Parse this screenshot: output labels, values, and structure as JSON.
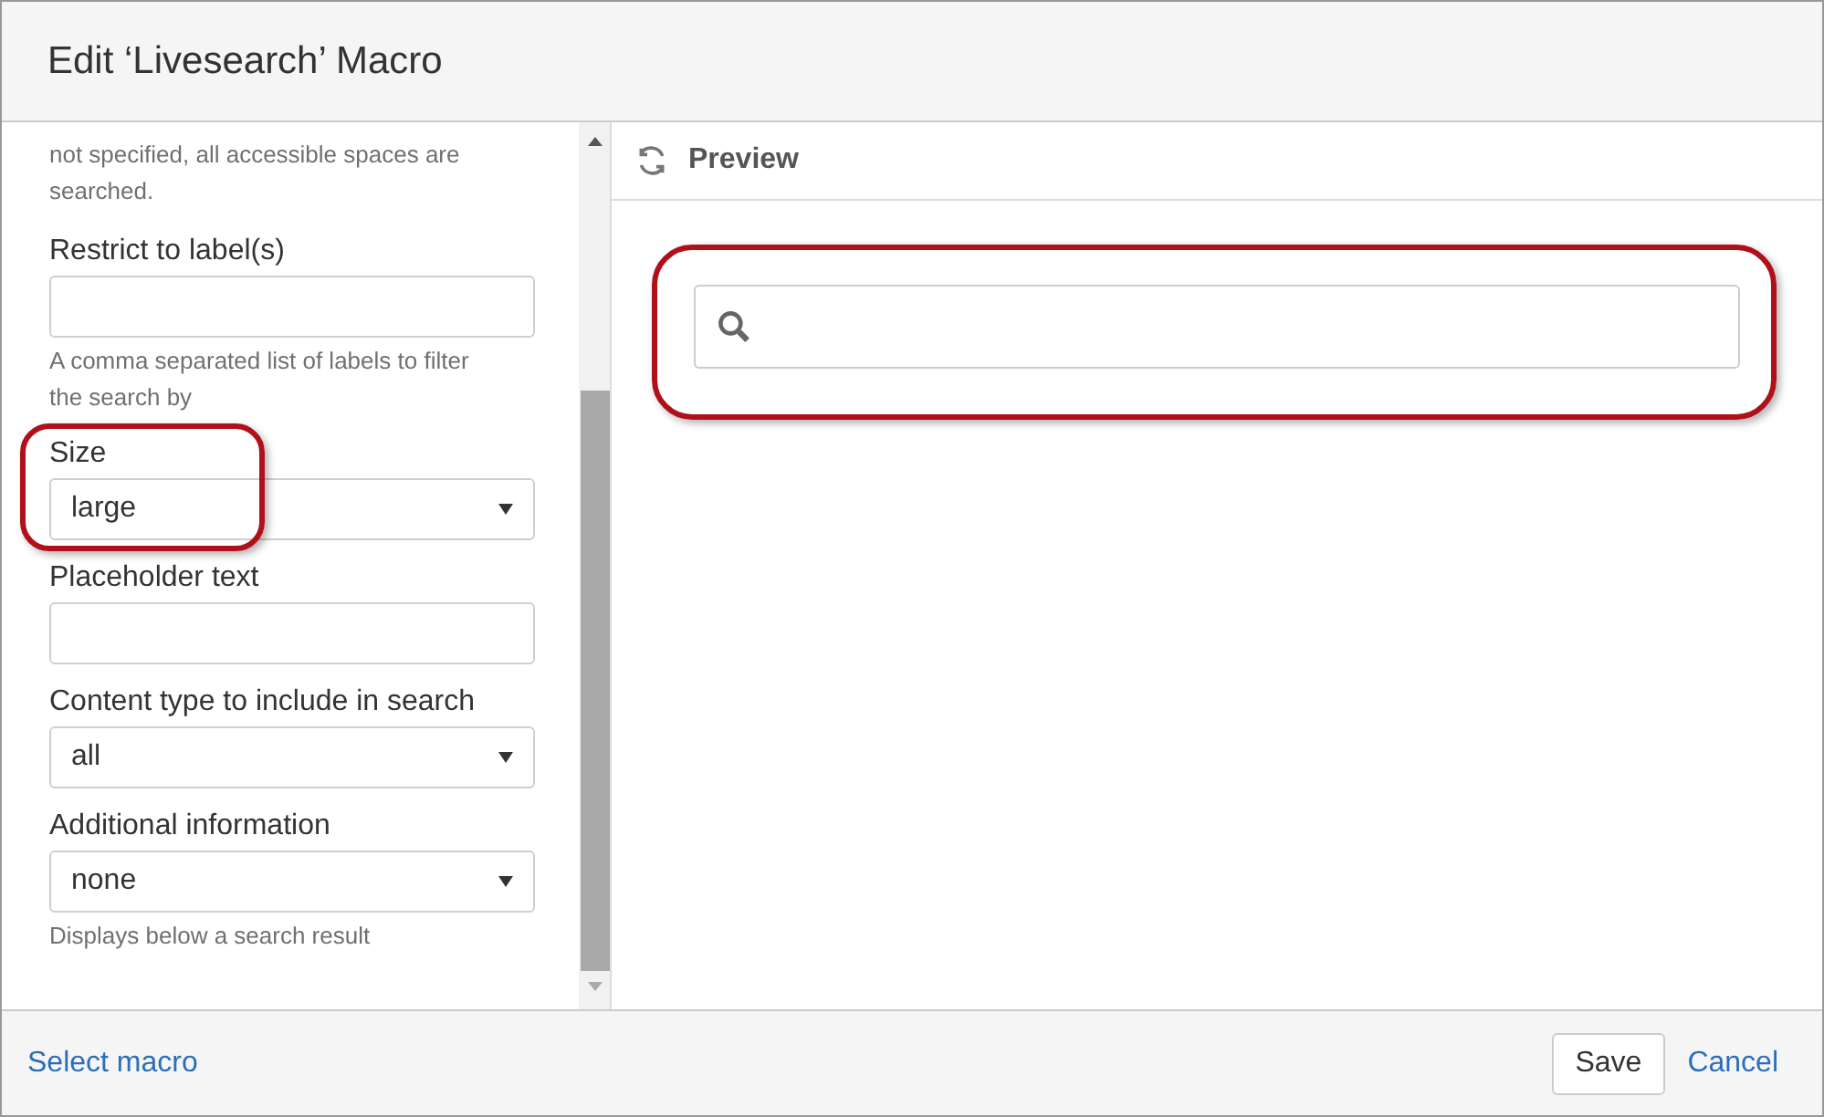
{
  "dialog": {
    "title": "Edit ‘Livesearch’ Macro"
  },
  "form": {
    "intro": "not specified, all accessible spaces are searched.",
    "fields": [
      {
        "kind": "text",
        "label": "Restrict to label(s)",
        "help": "A comma separated list of labels to filter the search by",
        "highlighted": false
      },
      {
        "kind": "select",
        "label": "Size",
        "value": "large",
        "highlighted": true
      },
      {
        "kind": "text",
        "label": "Placeholder text",
        "highlighted": false
      },
      {
        "kind": "select",
        "label": "Content type to include in search",
        "value": "all",
        "highlighted": false
      },
      {
        "kind": "select",
        "label": "Additional information",
        "value": "none",
        "help": "Displays below a search result",
        "highlighted": false
      }
    ]
  },
  "preview": {
    "title": "Preview",
    "search_highlighted": true
  },
  "footer": {
    "link": "Select macro",
    "buttons": [
      "Save",
      "Cancel"
    ]
  }
}
